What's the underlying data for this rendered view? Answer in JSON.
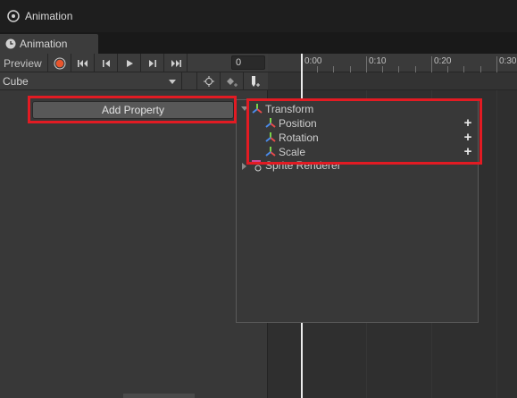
{
  "window": {
    "title": "Animation"
  },
  "tab": {
    "label": "Animation"
  },
  "toolbar": {
    "preview_label": "Preview",
    "frame_value": "0",
    "icons": [
      "record-icon",
      "first-key-icon",
      "prev-key-icon",
      "play-icon",
      "next-key-icon",
      "last-key-icon"
    ]
  },
  "clip": {
    "selected": "Cube"
  },
  "add_property": {
    "label": "Add Property"
  },
  "timeline": {
    "ticks": [
      "0:00",
      "0:10",
      "0:20",
      "0:30"
    ]
  },
  "popup": {
    "group": "Transform",
    "items": [
      {
        "label": "Position",
        "action": "+"
      },
      {
        "label": "Rotation",
        "action": "+"
      },
      {
        "label": "Scale",
        "action": "+"
      }
    ],
    "next_group": "Sprite Renderer"
  },
  "colors": {
    "highlight": "#e21b23",
    "record": "#e8552d",
    "playhead": "#ececec"
  }
}
